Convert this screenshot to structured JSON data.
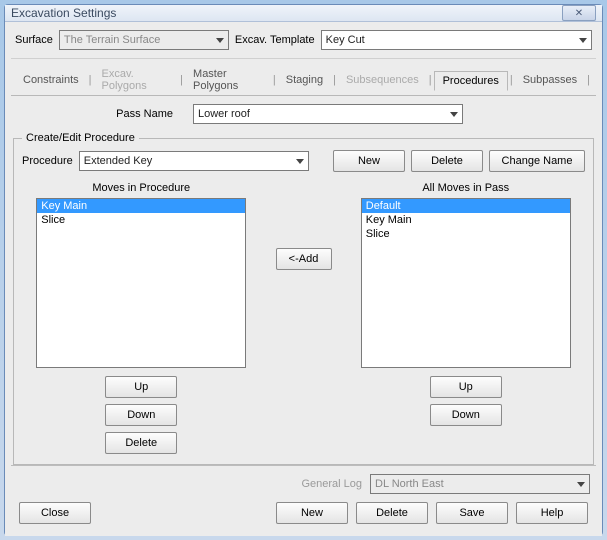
{
  "window": {
    "title": "Excavation Settings"
  },
  "top": {
    "surface_label": "Surface",
    "surface_value": "The Terrain Surface",
    "template_label": "Excav. Template",
    "template_value": "Key Cut"
  },
  "tabs": {
    "constraints": "Constraints",
    "excav_polygons": "Excav. Polygons",
    "master_polygons": "Master Polygons",
    "staging": "Staging",
    "subsequences": "Subsequences",
    "procedures": "Procedures",
    "subpasses": "Subpasses"
  },
  "pass": {
    "label": "Pass Name",
    "value": "Lower roof"
  },
  "group": {
    "legend": "Create/Edit Procedure",
    "procedure_label": "Procedure",
    "procedure_value": "Extended Key",
    "new": "New",
    "delete": "Delete",
    "change_name": "Change Name",
    "moves_header": "Moves in Procedure",
    "allmoves_header": "All Moves in Pass",
    "add": "<-Add",
    "up": "Up",
    "down": "Down",
    "del": "Delete",
    "left_items": [
      "Key Main",
      "Slice"
    ],
    "right_items": [
      "Default",
      "Key Main",
      "Slice"
    ]
  },
  "footer": {
    "general_log": "General Log",
    "general_log_value": "DL North East",
    "close": "Close",
    "new": "New",
    "delete": "Delete",
    "save": "Save",
    "help": "Help"
  }
}
